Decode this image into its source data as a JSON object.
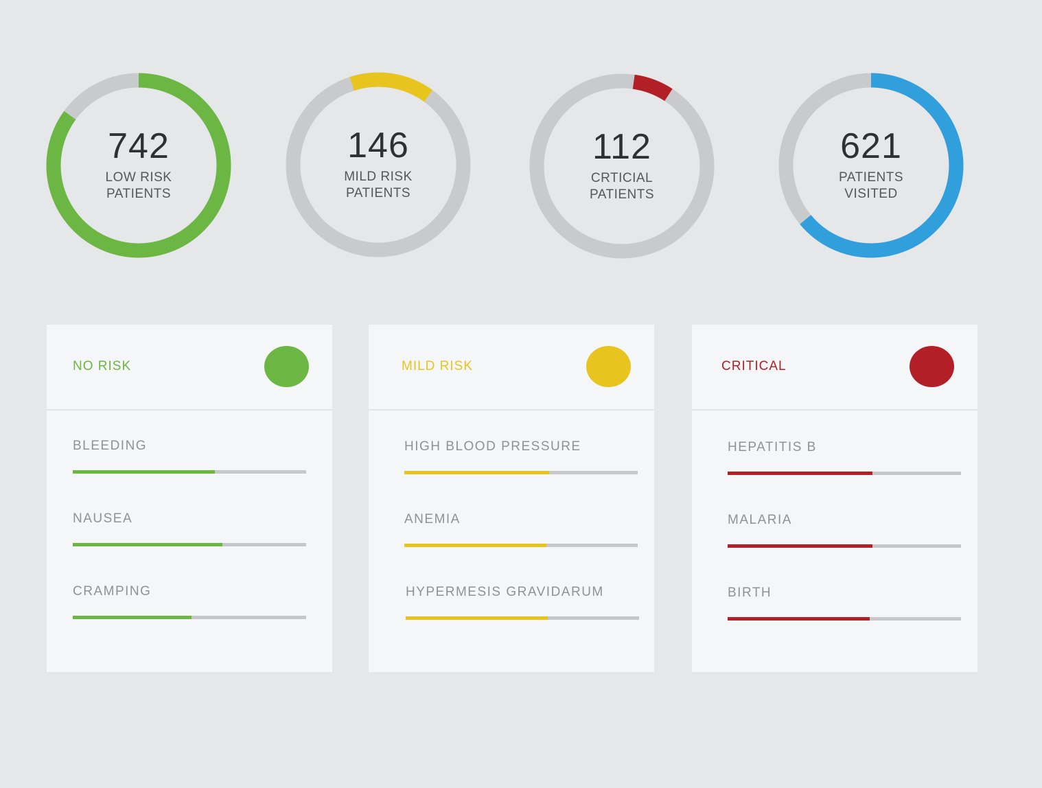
{
  "colors": {
    "green": "#6cb644",
    "yellow": "#e8c51e",
    "red": "#b21f27",
    "blue": "#319fdb",
    "track": "#c9cacc"
  },
  "stats": [
    {
      "value": "742",
      "label": "LOW RISK\nPATIENTS",
      "color": "#6cb644",
      "progress": 0.85
    },
    {
      "value": "146",
      "label": "MILD RISK\nPATIENTS",
      "color": "#e8c51e",
      "progress": 0.15
    },
    {
      "value": "112",
      "label": "CRTICIAL\nPATIENTS",
      "color": "#b21f27",
      "progress": 0.07
    },
    {
      "value": "621",
      "label": "PATIENTS\nVISITED",
      "color": "#319fdb",
      "progress": 0.64
    }
  ],
  "cards": [
    {
      "title": "NO RISK",
      "color": "#6cb644",
      "metrics": [
        {
          "label": "BLEEDING",
          "progress": 0.61
        },
        {
          "label": "NAUSEA",
          "progress": 0.64
        },
        {
          "label": "CRAMPING",
          "progress": 0.51
        }
      ]
    },
    {
      "title": "MILD RISK",
      "color": "#e8c51e",
      "metrics": [
        {
          "label": "HIGH BLOOD PRESSURE",
          "progress": 0.62
        },
        {
          "label": "ANEMIA",
          "progress": 0.61
        },
        {
          "label": "HYPERMESIS GRAVIDARUM",
          "progress": 0.61
        }
      ]
    },
    {
      "title": "CRITICAL",
      "color": "#b21f27",
      "metrics": [
        {
          "label": "HEPATITIS B",
          "progress": 0.62
        },
        {
          "label": "MALARIA",
          "progress": 0.62
        },
        {
          "label": "BIRTH",
          "progress": 0.61
        }
      ]
    }
  ]
}
